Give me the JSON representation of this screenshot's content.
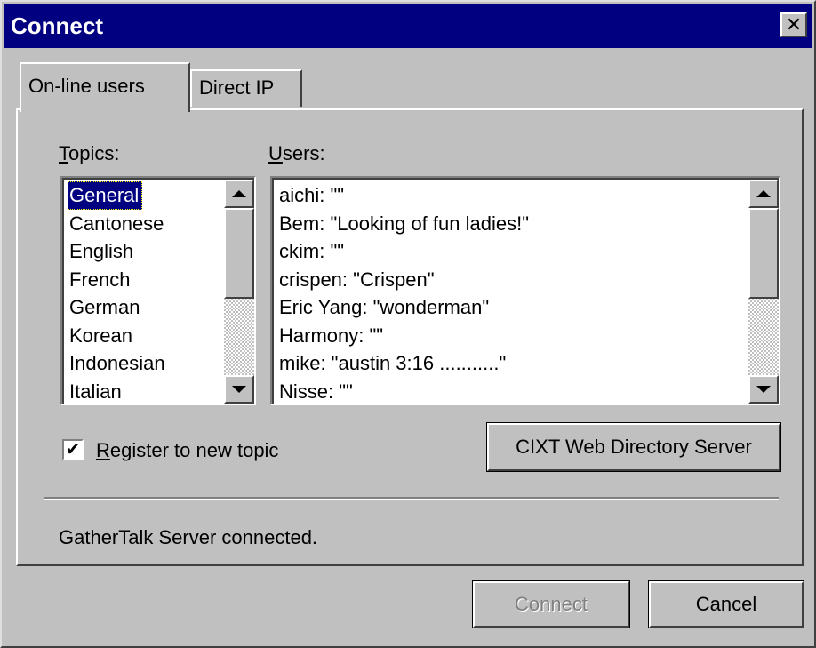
{
  "window": {
    "title": "Connect"
  },
  "tabs": [
    {
      "label": "On-line users",
      "active": true
    },
    {
      "label": "Direct IP",
      "active": false
    }
  ],
  "topics": {
    "label": "Topics:",
    "items": [
      "General",
      "Cantonese",
      "English",
      "French",
      "German",
      "Korean",
      "Indonesian",
      "Italian"
    ],
    "selected": "General"
  },
  "users": {
    "label": "Users:",
    "items": [
      "aichi: \"\"",
      "Bem: \"Looking of fun ladies!\"",
      "ckim: \"\"",
      "crispen: \"Crispen\"",
      "Eric Yang: \"wonderman\"",
      "Harmony: \"\"",
      "mike: \"austin 3:16 ...........\"",
      "Nisse: \"\""
    ]
  },
  "register": {
    "label": "Register to new topic",
    "checked": true
  },
  "directory_button": {
    "label": "CIXT Web Directory Server"
  },
  "status": {
    "text": "GatherTalk Server connected."
  },
  "footer": {
    "connect_label": "Connect",
    "cancel_label": "Cancel"
  },
  "colors": {
    "titlebar": "#000080",
    "face": "#c0c0c0",
    "selection": "#000080"
  }
}
